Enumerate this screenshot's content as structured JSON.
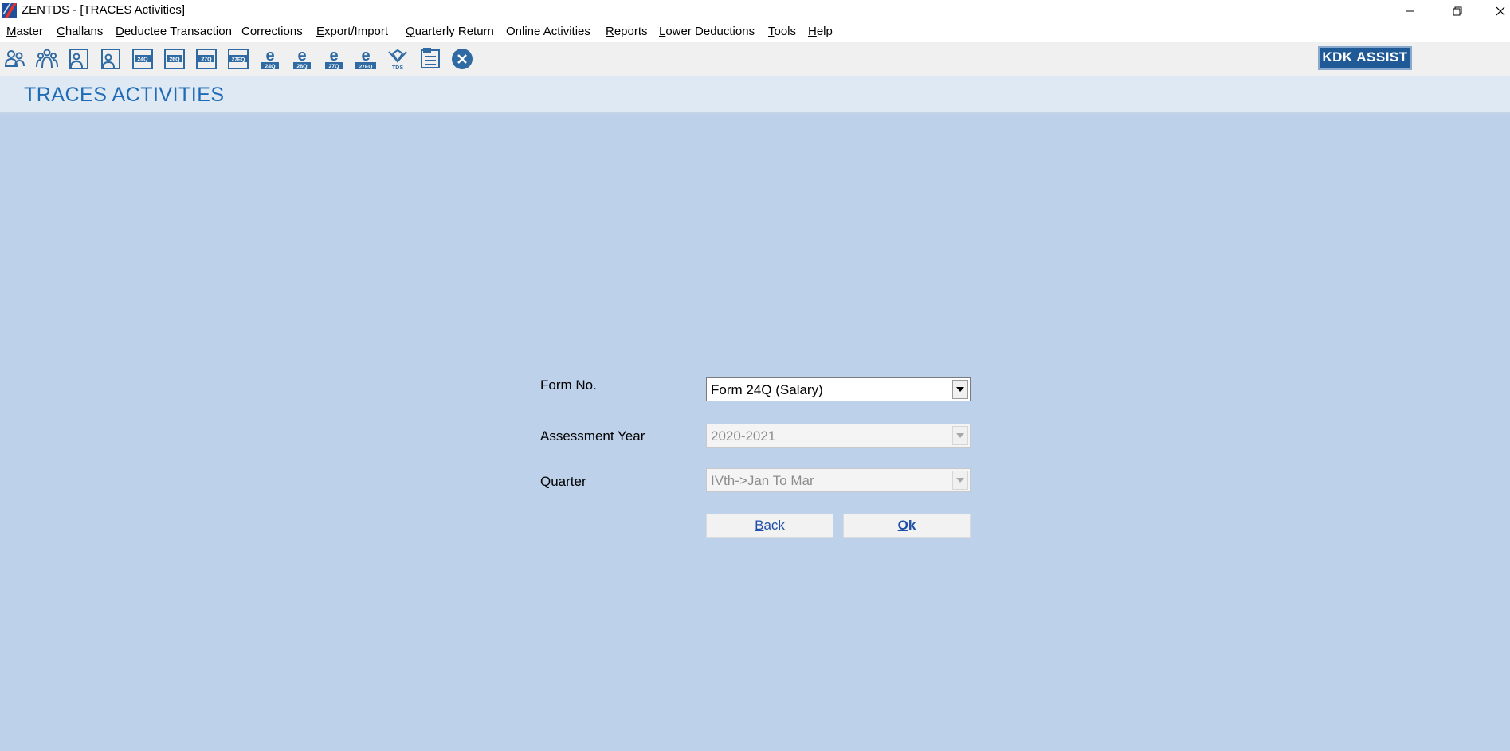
{
  "window": {
    "title": "ZENTDS - [TRACES Activities]"
  },
  "menu": {
    "items": [
      {
        "ul": "M",
        "rest": "aster"
      },
      {
        "ul": "C",
        "rest": "hallans"
      },
      {
        "ul": "D",
        "rest": "eductee Transaction"
      },
      {
        "ul": "",
        "rest": "Corrections"
      },
      {
        "ul": "E",
        "rest": "xport/Import"
      },
      {
        "ul": "Q",
        "rest": "uarterly Return"
      },
      {
        "ul": "",
        "rest": "Online Activities"
      },
      {
        "ul": "R",
        "rest": "eports"
      },
      {
        "ul": "L",
        "rest": "ower Deductions"
      },
      {
        "ul": "T",
        "rest": "ools"
      },
      {
        "ul": "H",
        "rest": "elp"
      }
    ]
  },
  "toolbar": {
    "icons": [
      {
        "name": "deductor-icon",
        "label": ""
      },
      {
        "name": "deductees-icon",
        "label": ""
      },
      {
        "name": "employee-icon",
        "label": ""
      },
      {
        "name": "party-icon",
        "label": ""
      },
      {
        "name": "form-icon",
        "label": "24Q"
      },
      {
        "name": "form-icon",
        "label": "26Q"
      },
      {
        "name": "form-icon",
        "label": "27Q"
      },
      {
        "name": "form-icon",
        "label": "27EQ"
      },
      {
        "name": "e-return-icon",
        "label": "24Q"
      },
      {
        "name": "e-return-icon",
        "label": "26Q"
      },
      {
        "name": "e-return-icon",
        "label": "27Q"
      },
      {
        "name": "e-return-icon",
        "label": "27EQ"
      },
      {
        "name": "tds-logo-icon",
        "label": "TDS"
      },
      {
        "name": "report-icon",
        "label": ""
      },
      {
        "name": "close-circle-icon",
        "label": ""
      }
    ],
    "assist_label": "KDK ASSIST",
    "accent": "#1f5a97"
  },
  "header": {
    "title": "TRACES ACTIVITIES"
  },
  "form": {
    "form_no_label": "Form No.",
    "form_no_value": "Form 24Q (Salary)",
    "assessment_year_label": "Assessment Year",
    "assessment_year_value": "2020-2021",
    "quarter_label": "Quarter",
    "quarter_value": "IVth->Jan To Mar",
    "back_ul": "B",
    "back_rest": "ack",
    "ok_ul": "O",
    "ok_rest": "k"
  },
  "colors": {
    "background": "#bdd1ea",
    "header_bg": "#dfe9f4",
    "header_text": "#1f6bb5"
  }
}
